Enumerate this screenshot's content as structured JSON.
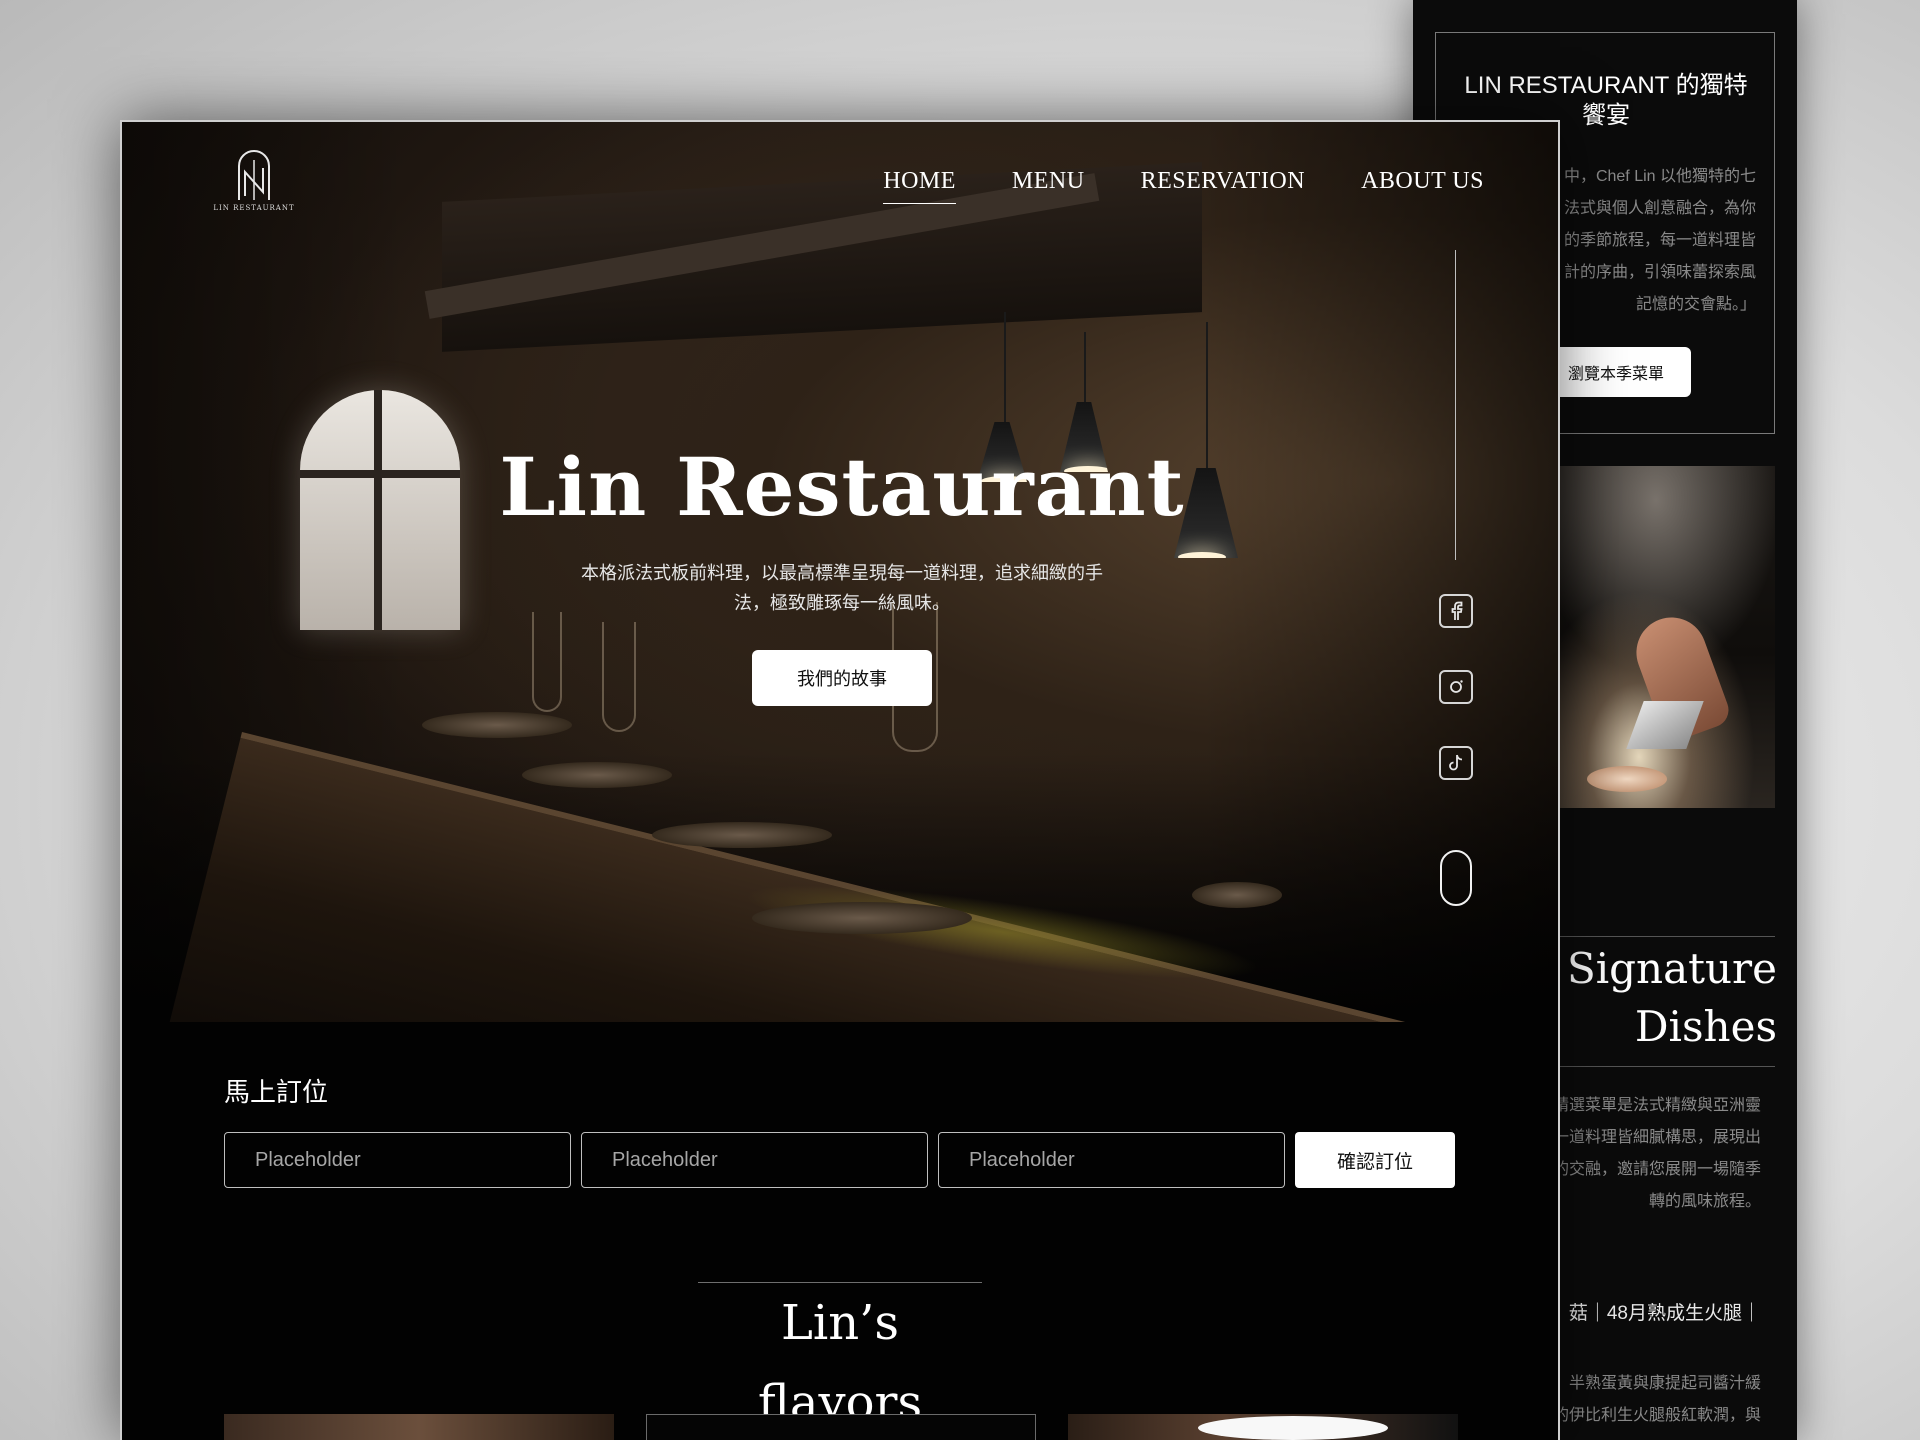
{
  "back_page": {
    "title": "LIN RESTAURANT 的獨特饗宴",
    "intro_lines": [
      "中，Chef Lin 以他獨特的七",
      "法式與個人創意融合，為你",
      "的季節旅程，每一道料理皆",
      "計的序曲，引領味蕾探索風",
      "記憶的交會點。」"
    ],
    "menu_button": "瀏覽本季菜單",
    "signature_title": "Signature Dishes",
    "signature_lines": [
      "精選菜單是法式精緻與亞洲靈",
      "一道料理皆細膩構思，展現出",
      "的交融，邀請您展開一場隨季",
      "轉的風味旅程。"
    ],
    "dish_name": "菇｜48月熟成生火腿｜",
    "dish_desc_lines": [
      "，半熟蛋黃與康提起司醬汁緩",
      "的伊比利生火腿般紅軟潤，與"
    ]
  },
  "header": {
    "logo_text": "LIN RESTAURANT",
    "nav": [
      {
        "label": "HOME",
        "active": true
      },
      {
        "label": "MENU",
        "active": false
      },
      {
        "label": "RESERVATION",
        "active": false
      },
      {
        "label": "ABOUT US",
        "active": false
      }
    ]
  },
  "hero": {
    "title": "Lin Restaurant",
    "subtitle_lines": [
      "本格派法式板前料理，以最高標準呈現每一道料理，追求細緻的手",
      "法，極致雕琢每一絲風味。"
    ],
    "cta": "我們的故事"
  },
  "social": {
    "icons": [
      "facebook-icon",
      "instagram-icon",
      "tiktok-icon"
    ]
  },
  "booking": {
    "label": "馬上訂位",
    "fields": [
      {
        "placeholder": "Placeholder"
      },
      {
        "placeholder": "Placeholder"
      },
      {
        "placeholder": "Placeholder"
      }
    ],
    "submit": "確認訂位"
  },
  "flavors": {
    "title": "Lin’s flavors"
  },
  "colors": {
    "background": "#020202",
    "text": "#ffffff",
    "muted": "#8a8a8a",
    "button_bg": "#ffffff"
  }
}
